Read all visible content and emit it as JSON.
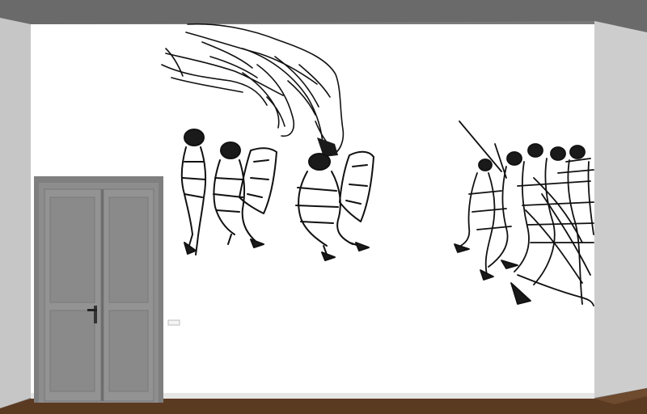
{
  "scene": {
    "type": "interior-wall-mural-visualization",
    "colors": {
      "ceiling": "#6b6b6b",
      "wall": "#ffffff",
      "left_wall": "#c9c9c9",
      "right_wall": "#cfcfcf",
      "floor": "#5a3b24",
      "door": "#8e8e8e",
      "ink": "#111111"
    },
    "icons": [
      "hand-icon",
      "riot-police-figure",
      "crowd-figure",
      "door-handle-icon",
      "light-switch-icon"
    ]
  }
}
